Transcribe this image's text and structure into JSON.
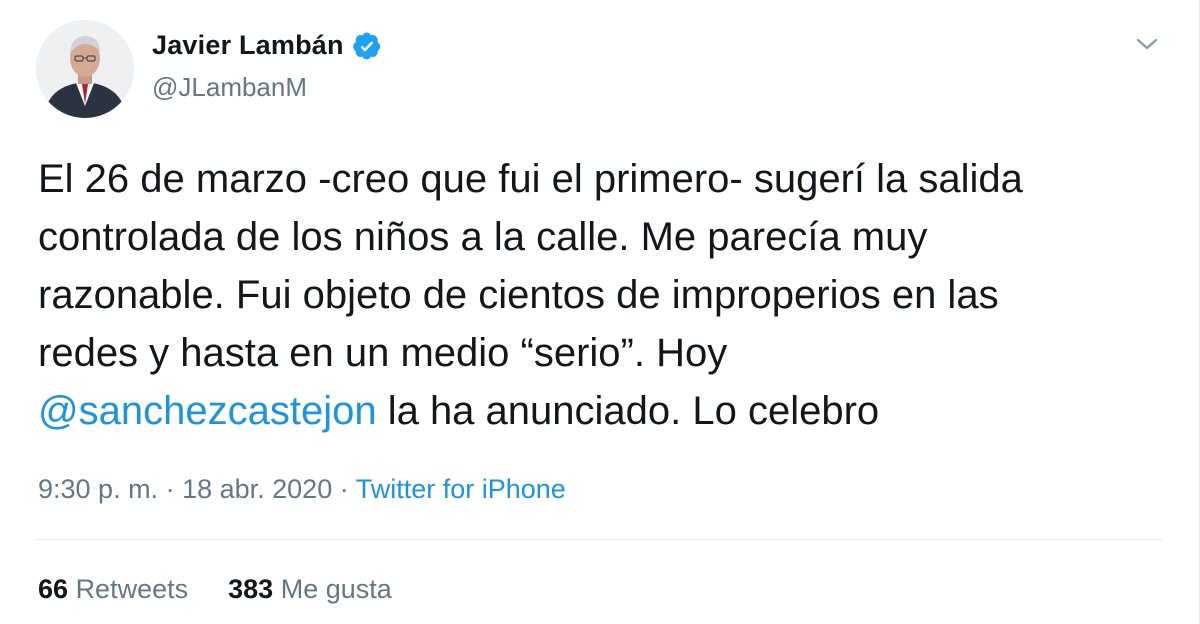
{
  "user": {
    "display_name": "Javier Lambán",
    "handle": "@JLambanM",
    "verified": true,
    "avatar_icon": "profile-photo"
  },
  "tweet": {
    "lines": [
      "El 26 de marzo -creo que fui el primero- sugerí la salida",
      "controlada de los niños a la calle. Me parecía muy",
      "razonable. Fui objeto de cientos de improperios en las",
      "redes y hasta en un medio “serio”. Hoy"
    ],
    "mention": "@sanchezcastejon",
    "tail": " la ha anunciado. Lo celebro"
  },
  "meta": {
    "time": "9:30 p. m.",
    "separator1": " · ",
    "date": "18 abr. 2020",
    "separator2": " · ",
    "source": "Twitter for iPhone"
  },
  "stats": {
    "retweets_count": "66",
    "retweets_label": "Retweets",
    "likes_count": "383",
    "likes_label": "Me gusta"
  },
  "colors": {
    "link": "#1b95e0",
    "verified": "#1da1f2",
    "secondary_text": "#657786",
    "primary_text": "#14171a"
  },
  "icons": {
    "verified": "verified-badge-icon",
    "caret": "chevron-down-icon"
  }
}
